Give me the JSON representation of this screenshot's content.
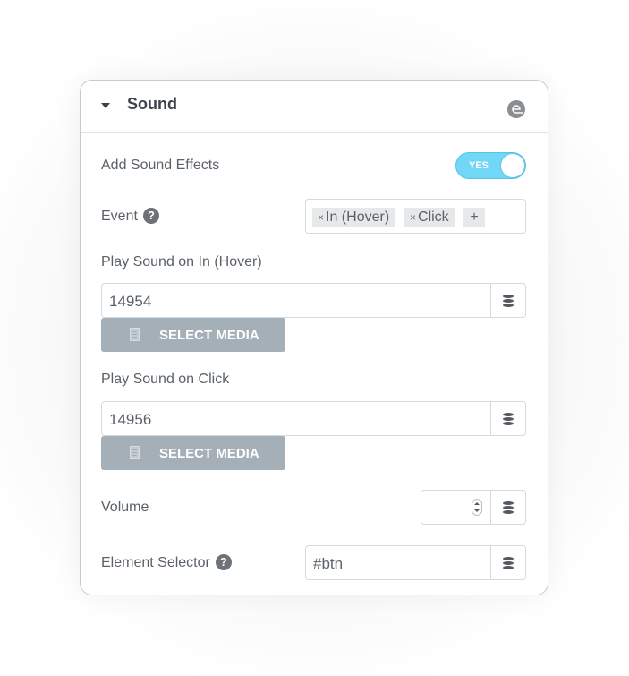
{
  "section": {
    "title": "Sound",
    "collapse_icon": "caret-down-icon",
    "brand_icon": "elementor-e-icon"
  },
  "controls": {
    "add_sound_effects": {
      "label": "Add Sound Effects",
      "toggle_text": "YES",
      "enabled": true,
      "accent": "#71d7f7"
    },
    "event": {
      "label": "Event",
      "help_icon": "?",
      "selected": [
        {
          "remove": "×",
          "label": "In (Hover)"
        },
        {
          "remove": "×",
          "label": "Click"
        }
      ],
      "add": "+"
    },
    "play_hover": {
      "label": "Play Sound on In (Hover)",
      "value": "14954",
      "button": "SELECT MEDIA"
    },
    "play_click": {
      "label": "Play Sound on Click",
      "value": "14956",
      "button": "SELECT MEDIA"
    },
    "volume": {
      "label": "Volume",
      "value": ""
    },
    "element_selector": {
      "label": "Element Selector",
      "help_icon": "?",
      "value": "#btn"
    }
  }
}
